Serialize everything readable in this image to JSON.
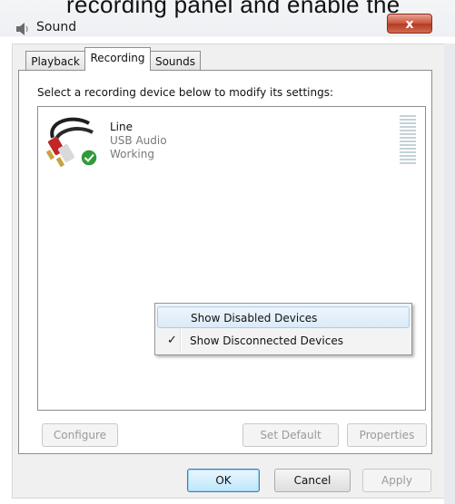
{
  "caption": "recording panel and enable the",
  "window": {
    "title": "Sound",
    "close_label": "x"
  },
  "tabs": [
    {
      "label": "Playback",
      "active": false
    },
    {
      "label": "Recording",
      "active": true
    },
    {
      "label": "Sounds",
      "active": false
    }
  ],
  "recording": {
    "instruction": "Select a recording device below to modify its settings:",
    "devices": [
      {
        "name": "Line",
        "description": "USB Audio",
        "status": "Working",
        "icon": "line-in-cable-icon",
        "default_check": "check-badge-icon"
      }
    ]
  },
  "context_menu": {
    "items": [
      {
        "label": "Show Disabled Devices",
        "checked": false,
        "highlighted": true
      },
      {
        "label": "Show Disconnected Devices",
        "checked": true,
        "highlighted": false,
        "check_glyph": "✓"
      }
    ]
  },
  "panel_buttons": {
    "configure": "Configure",
    "set_default": "Set Default",
    "properties": "Properties"
  },
  "dialog_buttons": {
    "ok": "OK",
    "cancel": "Cancel",
    "apply": "Apply"
  },
  "colors": {
    "close_button": "#c9513b",
    "menu_highlight": "#dbeaf9",
    "default_button_border": "#3c7fb1"
  }
}
